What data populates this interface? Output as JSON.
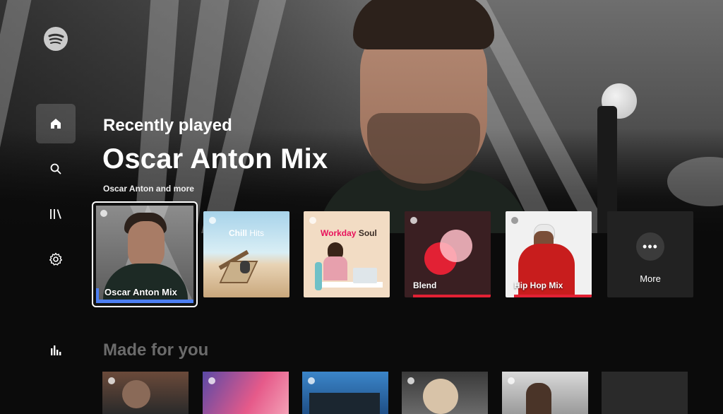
{
  "app": {
    "name": "Spotify"
  },
  "nav": [
    {
      "id": "home",
      "icon": "home-icon",
      "active": true
    },
    {
      "id": "search",
      "icon": "search-icon",
      "active": false
    },
    {
      "id": "library",
      "icon": "library-icon",
      "active": false
    },
    {
      "id": "settings",
      "icon": "gear-icon",
      "active": false
    },
    {
      "id": "stats",
      "icon": "bar-chart-icon",
      "active": false
    }
  ],
  "hero": {
    "section": "Recently played",
    "title": "Oscar Anton Mix",
    "subtitle": "Oscar Anton and more"
  },
  "recently_played": [
    {
      "label": "Oscar Anton Mix",
      "focused": true
    },
    {
      "label": "Chill Hits"
    },
    {
      "label": "Workday Soul"
    },
    {
      "label": "Blend"
    },
    {
      "label": "Hip Hop Mix"
    },
    {
      "label": "More",
      "icon": "more-dots-icon"
    }
  ],
  "chill_hits": {
    "word1": "Chill",
    "word2": "Hits"
  },
  "workday_soul": {
    "word1": "Workday",
    "word2": "Soul"
  },
  "made_for_you": {
    "title": "Made for you"
  },
  "colors": {
    "accent_red": "#e22134",
    "focus_blue": "#4d7ff2",
    "workday_pink": "#e8115b",
    "blend_bg": "#3a1f22"
  }
}
